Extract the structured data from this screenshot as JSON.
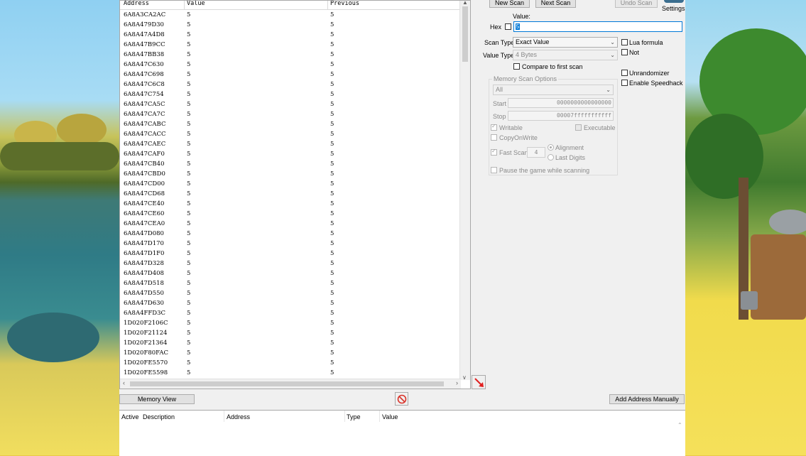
{
  "results": {
    "columns": [
      "Address",
      "Value",
      "Previous"
    ],
    "rows": [
      {
        "address": "6A8A3CA2AC",
        "value": "5",
        "previous": "5"
      },
      {
        "address": "6A8A479D30",
        "value": "5",
        "previous": "5"
      },
      {
        "address": "6A8A47A4D8",
        "value": "5",
        "previous": "5"
      },
      {
        "address": "6A8A47B9CC",
        "value": "5",
        "previous": "5"
      },
      {
        "address": "6A8A47BB38",
        "value": "5",
        "previous": "5"
      },
      {
        "address": "6A8A47C630",
        "value": "5",
        "previous": "5"
      },
      {
        "address": "6A8A47C698",
        "value": "5",
        "previous": "5"
      },
      {
        "address": "6A8A47C6C8",
        "value": "5",
        "previous": "5"
      },
      {
        "address": "6A8A47C754",
        "value": "5",
        "previous": "5"
      },
      {
        "address": "6A8A47CA5C",
        "value": "5",
        "previous": "5"
      },
      {
        "address": "6A8A47CA7C",
        "value": "5",
        "previous": "5"
      },
      {
        "address": "6A8A47CABC",
        "value": "5",
        "previous": "5"
      },
      {
        "address": "6A8A47CACC",
        "value": "5",
        "previous": "5"
      },
      {
        "address": "6A8A47CAEC",
        "value": "5",
        "previous": "5"
      },
      {
        "address": "6A8A47CAF0",
        "value": "5",
        "previous": "5"
      },
      {
        "address": "6A8A47CB40",
        "value": "5",
        "previous": "5"
      },
      {
        "address": "6A8A47CBD0",
        "value": "5",
        "previous": "5"
      },
      {
        "address": "6A8A47CD00",
        "value": "5",
        "previous": "5"
      },
      {
        "address": "6A8A47CD68",
        "value": "5",
        "previous": "5"
      },
      {
        "address": "6A8A47CE40",
        "value": "5",
        "previous": "5"
      },
      {
        "address": "6A8A47CE60",
        "value": "5",
        "previous": "5"
      },
      {
        "address": "6A8A47CEA0",
        "value": "5",
        "previous": "5"
      },
      {
        "address": "6A8A47D080",
        "value": "5",
        "previous": "5"
      },
      {
        "address": "6A8A47D170",
        "value": "5",
        "previous": "5"
      },
      {
        "address": "6A8A47D1F0",
        "value": "5",
        "previous": "5"
      },
      {
        "address": "6A8A47D328",
        "value": "5",
        "previous": "5"
      },
      {
        "address": "6A8A47D408",
        "value": "5",
        "previous": "5"
      },
      {
        "address": "6A8A47D518",
        "value": "5",
        "previous": "5"
      },
      {
        "address": "6A8A47D550",
        "value": "5",
        "previous": "5"
      },
      {
        "address": "6A8A47D630",
        "value": "5",
        "previous": "5"
      },
      {
        "address": "6A8A4FFD3C",
        "value": "5",
        "previous": "5"
      },
      {
        "address": "1D020F2106C",
        "value": "5",
        "previous": "5"
      },
      {
        "address": "1D020F21124",
        "value": "5",
        "previous": "5"
      },
      {
        "address": "1D020F21364",
        "value": "5",
        "previous": "5"
      },
      {
        "address": "1D020F80FAC",
        "value": "5",
        "previous": "5"
      },
      {
        "address": "1D020FE5570",
        "value": "5",
        "previous": "5"
      },
      {
        "address": "1D020FE5598",
        "value": "5",
        "previous": "5"
      }
    ]
  },
  "scan": {
    "new_scan": "New Scan",
    "next_scan": "Next Scan",
    "undo_scan": "Undo Scan",
    "settings": "Settings",
    "value_label": "Value:",
    "hex_label": "Hex",
    "value_input": "5",
    "scan_type_label": "Scan Type",
    "scan_type_value": "Exact Value",
    "value_type_label": "Value Type",
    "value_type_value": "4 Bytes",
    "compare_first": "Compare to first scan",
    "lua_formula": "Lua formula",
    "not": "Not",
    "unrandomizer": "Unrandomizer",
    "enable_speedhack": "Enable Speedhack"
  },
  "memory_options": {
    "title": "Memory Scan Options",
    "region": "All",
    "start_label": "Start",
    "start_value": "0000000000000000",
    "stop_label": "Stop",
    "stop_value": "00007fffffffffff",
    "writable": "Writable",
    "executable": "Executable",
    "copy_on_write": "CopyOnWrite",
    "fast_scan": "Fast Scan",
    "fast_scan_value": "4",
    "alignment": "Alignment",
    "last_digits": "Last Digits",
    "pause_game": "Pause the game while scanning"
  },
  "bottom": {
    "memory_view": "Memory View",
    "add_address": "Add Address Manually"
  },
  "address_table": {
    "columns": [
      "Active",
      "Description",
      "Address",
      "Type",
      "Value"
    ]
  },
  "colors": {
    "accent": "#0078d7",
    "stop_icon": "#d9342b",
    "arrow_icon": "#e02020"
  },
  "icons": {
    "settings": "settings-logo-icon",
    "arrow": "red-arrow-icon",
    "stop": "stop-icon"
  }
}
